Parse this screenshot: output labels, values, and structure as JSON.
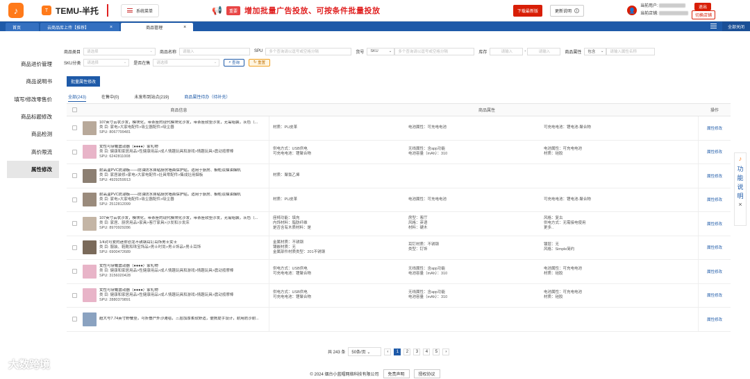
{
  "header": {
    "brand": "TEMU-半托",
    "sys_menu": "系统菜单",
    "ad_tag": "重要",
    "ad_text": "增加批量广告投放、可按条件批量投放",
    "download": "下载最新版",
    "update": "更新说明",
    "user_label": "当前用户:",
    "store_label": "当前店铺:",
    "logout": "退出",
    "switch_store": "切换店铺"
  },
  "tabs": [
    {
      "label": "首页"
    },
    {
      "label": "云商品库上传【推荐】"
    },
    {
      "label": "商品管理"
    }
  ],
  "close_all": "全部关闭",
  "sidebar": [
    "商品进价管理",
    "商品说明书",
    "填写/修改零售价",
    "商品标题修改",
    "商品检测",
    "高价限流",
    "属性修改"
  ],
  "filters": {
    "category": "商品类目",
    "category_ph": "请选择",
    "name": "商品名称",
    "name_ph": "请输入",
    "spu": "SPU",
    "spu_ph": "多个查询请以逗号或空格分隔",
    "sku_label": "货号",
    "sku_sel": "SKU",
    "sku_ph": "多个查询请以逗号或空格分隔",
    "stock": "库存",
    "stock_ph": "请输入",
    "attr": "商品属性",
    "attr_sel": "包含",
    "attr_ph": "请输入属性名称",
    "sku_cat": "SKU分类",
    "sku_cat_ph": "请选择",
    "onsale": "是否在售",
    "onsale_ph": "请选择",
    "query": "查询",
    "reset": "重置"
  },
  "batch": "批量属性修改",
  "subtabs": [
    "全部(243)",
    "在售中(0)",
    "未发布到站点(219)",
    "商品属性待办（待补充）"
  ],
  "table": {
    "col_info": "商品信息",
    "col_attr": "商品属性",
    "col_op": "操作",
    "op_label": "属性修改"
  },
  "rows": [
    {
      "t": "107英寸云状沙发，模块化，带茶座的现代模块化沙发，带茶座软垫沙发，无需组装，灰色（...",
      "c": "类 目:  家电>大家电配件>吸尘器配件>吸尘器",
      "s": "SPU:    8067799481",
      "a": [
        "材质：PU皮革",
        "电池属性：可充电电池",
        "可充电电池：锂电池-聚合物"
      ]
    },
    {
      "t": "女性可穿戴震动器（●●●●）家礼物",
      "c": "类 目:  健康和家居用品>性健康用品>成人情趣玩具和游戏>情趣玩具>震动按摩棒",
      "s": "SPU:    6242811008",
      "a": [
        "供电方式：USB供电\n可充电电池：锂聚合物",
        "无线属性：含app功能\n电池容量（mAh）：310",
        "电池属性：可充电电池\n材质：硅胶"
      ]
    },
    {
      "t": "耐高温PVC防潮板——防油防水自粘厨房墙面保护贴，适用于厨房、橱柜及抽油烟机",
      "c": "类 目:  家居装修>家电>大家电配件>灶具零配件>集成灶用烟板",
      "s": "SPU:    4929259913",
      "a": [
        "材质：聚氯乙烯",
        "",
        ""
      ]
    },
    {
      "t": "耐高温PVC防潮板——防油防水自粘厨房墙面保护贴，适用于厨房、橱柜及抽油烟机",
      "c": "类 目:  家电>大家电配件>吸尘器配件>吸尘器",
      "s": "SPU:    2512812099",
      "a": [
        "材质：PU皮革",
        "电池属性：可充电电池",
        "可充电电池：锂电池-聚合物"
      ]
    },
    {
      "t": "107英寸云状沙发，模块化，带茶座的现代模块化沙发，带茶座软垫沙发，无需组装，灰色（...",
      "c": "类 目:  家居、厨房用品>家具>客厅家具>沙发和沙发床",
      "s": "SPU:    8970929286",
      "a": [
        "座椅功能：填充\n内饰材料：脂肪纤维\n是否含有木质材料：是",
        "房型：客厅\n风格：英语\n材料：硬木",
        "风格：复古\n供电方式：无需接电使用\n更多.."
      ]
    },
    {
      "t": "1/4对可爱的迷你恐龙不锈钢耳钉耳饰男士女士",
      "c": "类 目:  服装、鞋靴和珠宝饰品>男士时尚>男士饰品>男士耳饰",
      "s": "SPU:    6900472689",
      "a": [
        "金属材质：不锈钢\n镶嵌材质：无\n金属部件材质类型：201不锈钢",
        "耳钉材质：不锈钢\n类型：钉饰",
        "镀层：无\n风格：Simple简约"
      ]
    },
    {
      "t": "女性可穿戴震动器（●●●●）家礼物",
      "c": "类 目:  健康和家居用品>性健康用品>成人情趣玩具和游戏>情趣玩具>震动按摩棒",
      "s": "SPU:    3156020428",
      "a": [
        "供电方式：USB供电\n可充电电池：锂聚合物",
        "无线属性：含app功能\n电池容量（mAh）：310",
        "电池属性：可充电电池\n材质：硅胶"
      ]
    },
    {
      "t": "女性可穿戴震动器（●●●●）家礼物",
      "c": "类 目:  健康和家居用品>性健康用品>成人情趣玩具和游戏>情趣玩具>震动按摩棒",
      "s": "SPU:    2880379891",
      "a": [
        "供电方式：USB供电\n可充电电池：锂聚合物",
        "无线属性：含app功能\n电池容量（mAh）：310",
        "电池属性：可充电电池\n材质：硅胶"
      ]
    },
    {
      "t": "超大号7.74英寸野餐垫，可折叠户外沙滩毯，三层加厚柔软舒适，便携提手设计，耐用防沙耐...",
      "c": "",
      "s": "",
      "a": [
        "",
        "",
        ""
      ]
    }
  ],
  "pagination": {
    "total": "共 243 条",
    "per": "50条/页",
    "pages": [
      "1",
      "2",
      "3",
      "4",
      "5"
    ]
  },
  "footer": {
    "copy": "© 2024 烟台小蓝帽网络科技有限公司",
    "b1": "免责声明",
    "b2": "授权协议"
  },
  "float_panel": {
    "label": "功能说明",
    "close": "×"
  },
  "watermark": "大数跨境",
  "colors": {
    "primary": "#1e5aa8",
    "accent": "#d81e06",
    "brand": "#ff7a1a"
  }
}
